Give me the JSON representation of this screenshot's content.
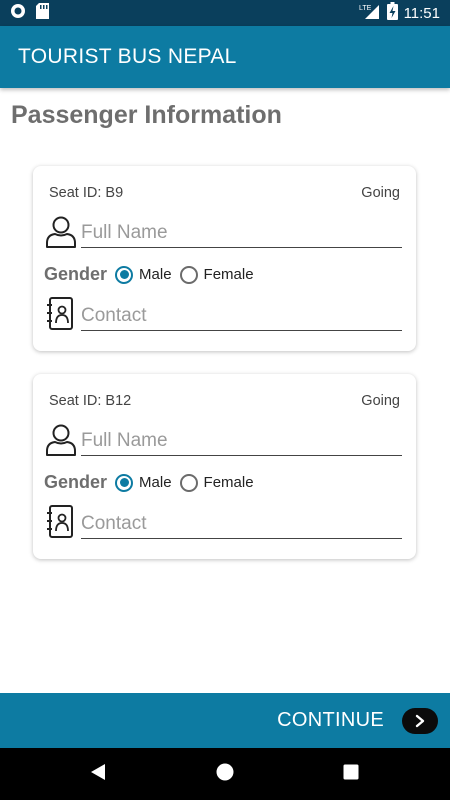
{
  "status_bar": {
    "time": "11:51",
    "network": "LTE",
    "icons": [
      "notification-icon",
      "sd-card-icon",
      "lte-signal-icon",
      "battery-charging-icon"
    ]
  },
  "app_bar": {
    "title": "TOURIST BUS NEPAL"
  },
  "page": {
    "title": "Passenger Information"
  },
  "passengers": [
    {
      "seat": "Seat ID: B9",
      "direction": "Going",
      "name_placeholder": "Full Name",
      "gender_label": "Gender",
      "gender_options": [
        "Male",
        "Female"
      ],
      "gender_selected": "Male",
      "contact_placeholder": "Contact"
    },
    {
      "seat": "Seat ID: B12",
      "direction": "Going",
      "name_placeholder": "Full Name",
      "gender_label": "Gender",
      "gender_options": [
        "Male",
        "Female"
      ],
      "gender_selected": "Male",
      "contact_placeholder": "Contact"
    }
  ],
  "footer": {
    "continue_label": "CONTINUE",
    "continue_icon": "chevron-right-icon"
  },
  "nav": {
    "icons": [
      "back-icon",
      "home-icon",
      "recents-icon"
    ]
  },
  "colors": {
    "primary": "#0d7ba2",
    "status_bar": "#0a3f5c",
    "title_gray": "#6e6e6e"
  }
}
